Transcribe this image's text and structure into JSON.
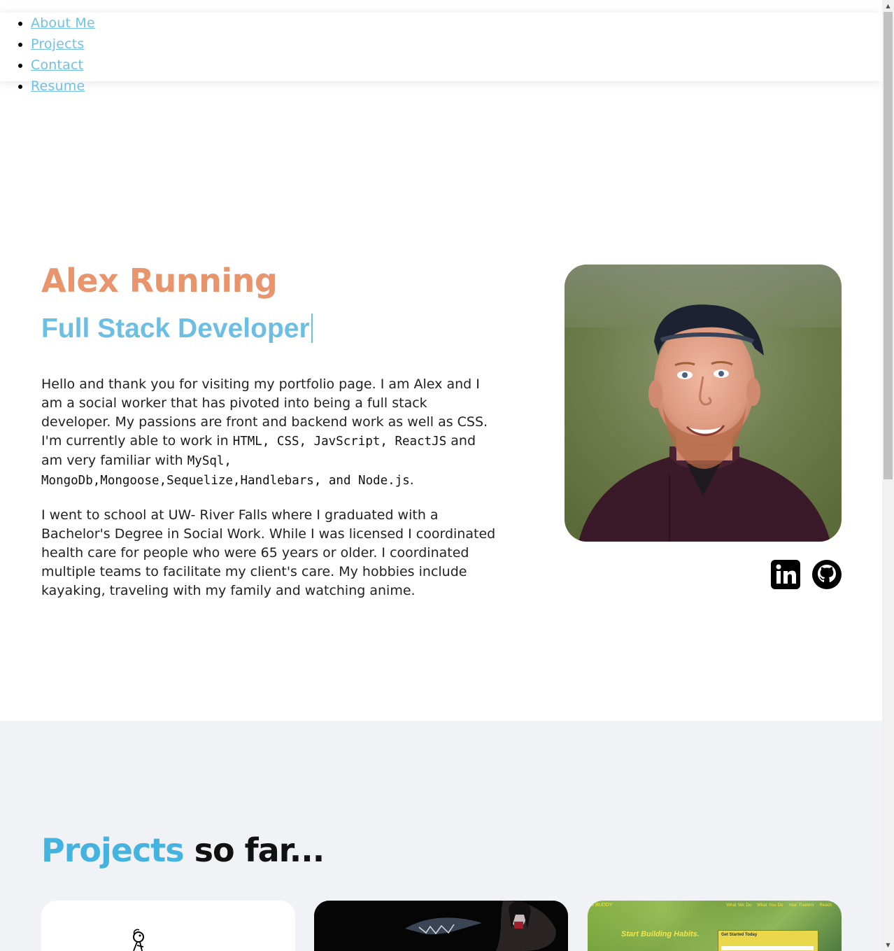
{
  "nav": {
    "items": [
      {
        "label": "About Me"
      },
      {
        "label": "Projects"
      },
      {
        "label": "Contact"
      },
      {
        "label": "Resume"
      }
    ]
  },
  "hero": {
    "name": "Alex Running",
    "role": "Full Stack Developer",
    "bio1": {
      "t1": "Hello and thank you for visiting my portfolio page. I am Alex and I am a social worker that has pivoted into being a full stack developer. My passions are front and backend work as well as CSS. I'm currently able to work in ",
      "code1": "HTML, CSS, JavScript, ReactJS",
      "t2": " and am very familiar with ",
      "code2": "MySql, MongoDb,Mongoose,Sequelize,Handlebars, and Node.js",
      "t3": "."
    },
    "bio2": "I went to school at UW- River Falls where I graduated with a Bachelor's Degree in Social Work. While I was licensed I coordinated health care for people who were 65 years or older. I coordinated multiple teams to facilitate my client's care. My hobbies include kayaking, traveling with my family and watching anime.",
    "photo_icon": "profile-photo",
    "social": [
      {
        "icon": "linkedin-icon"
      },
      {
        "icon": "github-icon"
      }
    ]
  },
  "projects": {
    "title_accent": "Projects",
    "title_rest": " so far...",
    "cards": [
      {
        "icon": "doodle-thumbnail"
      },
      {
        "icon": "dark-fantasy-thumbnail"
      },
      {
        "brand": "N BUDDY",
        "nav": [
          "What We Do",
          "What You Do",
          "Your Trainers",
          "Reach"
        ],
        "headline": "Start Building Habits.",
        "form_title": "Get Started Today"
      }
    ]
  },
  "colors": {
    "name": "#e8956e",
    "role": "#6cbfe3",
    "link": "#6fc2e6",
    "accent": "#45b3e0",
    "section_bg": "#f1f2f5"
  }
}
